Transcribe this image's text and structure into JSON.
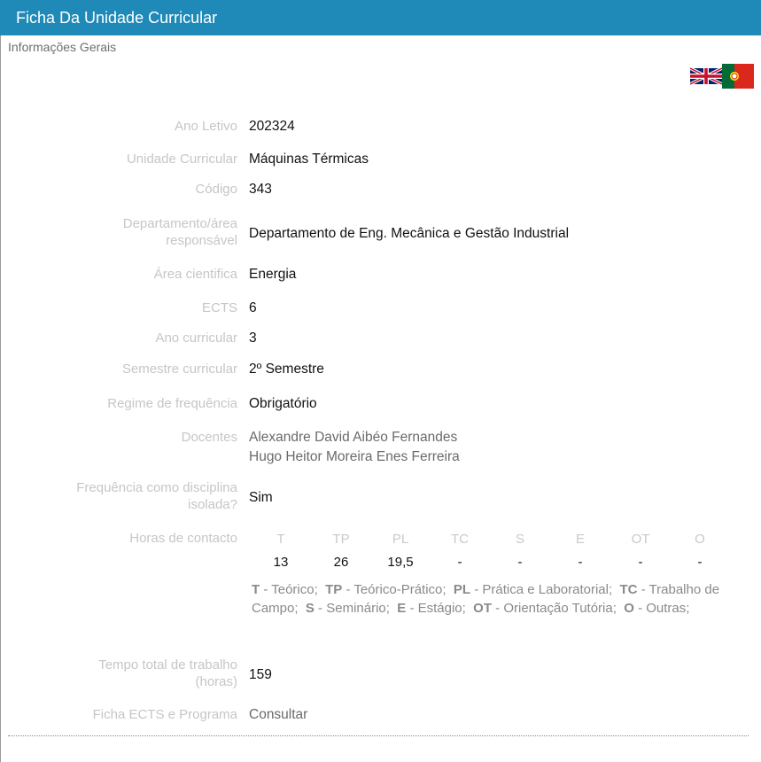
{
  "header": {
    "title": "Ficha Da Unidade Curricular"
  },
  "subtitle": "Informações Gerais",
  "fields": {
    "ano_letivo": {
      "label": "Ano Letivo",
      "value": "202324"
    },
    "unidade": {
      "label": "Unidade Curricular",
      "value": "Máquinas Térmicas"
    },
    "codigo": {
      "label": "Código",
      "value": "343"
    },
    "departamento": {
      "label_line1": "Departamento/área",
      "label_line2": "responsável",
      "value": "Departamento de Eng. Mecânica e Gestão Industrial"
    },
    "area": {
      "label": "Área cientifica",
      "value": "Energia"
    },
    "ects": {
      "label": "ECTS",
      "value": "6"
    },
    "ano_curricular": {
      "label": "Ano curricular",
      "value": "3"
    },
    "semestre": {
      "label": "Semestre curricular",
      "value": "2º Semestre"
    },
    "regime": {
      "label": "Regime de frequência",
      "value": "Obrigatório"
    },
    "docentes": {
      "label": "Docentes",
      "values": [
        "Alexandre David Aibéo Fernandes",
        "Hugo Heitor Moreira Enes Ferreira"
      ]
    },
    "isolada": {
      "label_line1": "Frequência como disciplina",
      "label_line2": "isolada?",
      "value": "Sim"
    },
    "horas": {
      "label": "Horas de contacto",
      "columns": [
        {
          "head": "T",
          "value": "13"
        },
        {
          "head": "TP",
          "value": "26"
        },
        {
          "head": "PL",
          "value": "19,5"
        },
        {
          "head": "TC",
          "value": "-"
        },
        {
          "head": "S",
          "value": "-"
        },
        {
          "head": "E",
          "value": "-"
        },
        {
          "head": "OT",
          "value": "-"
        },
        {
          "head": "O",
          "value": "-"
        }
      ],
      "legend": [
        {
          "abbr": "T",
          "desc": " - Teórico;"
        },
        {
          "abbr": "TP",
          "desc": " - Teórico-Prático;"
        },
        {
          "abbr": "PL",
          "desc": " - Prática e Laboratorial;"
        },
        {
          "abbr": "TC",
          "desc": " - Trabalho de Campo;"
        },
        {
          "abbr": "S",
          "desc": " - Seminário;"
        },
        {
          "abbr": "E",
          "desc": " - Estágio;"
        },
        {
          "abbr": "OT",
          "desc": " - Orientação Tutória;"
        },
        {
          "abbr": "O",
          "desc": " - Outras;"
        }
      ]
    },
    "tempo": {
      "label_line1": "Tempo total de trabalho",
      "label_line2": "(horas)",
      "value": "159"
    },
    "ficha": {
      "label": "Ficha ECTS e Programa",
      "value": "Consultar"
    }
  },
  "icons": {
    "flag_en": "uk-flag-icon",
    "flag_pt": "portugal-flag-icon"
  },
  "colors": {
    "header_bg": "#1f8ab8",
    "label": "#c6c6c6"
  }
}
